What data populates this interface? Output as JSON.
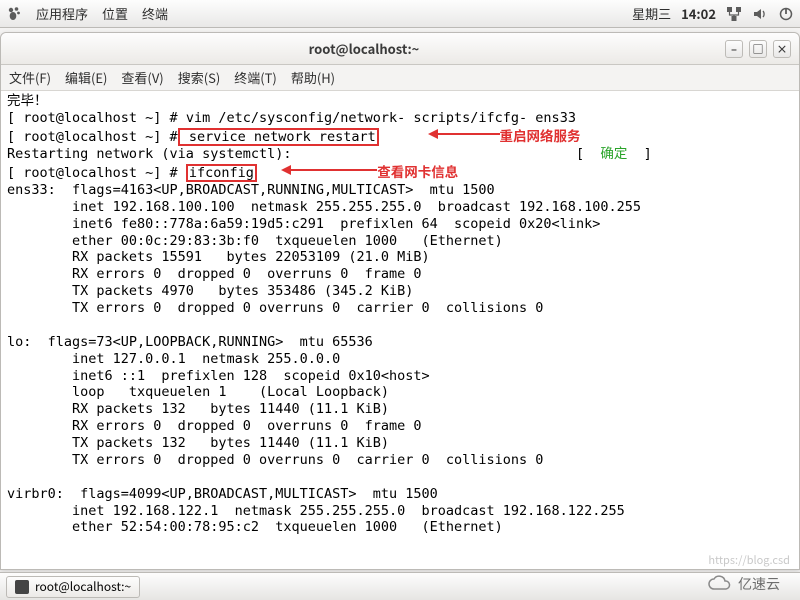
{
  "panel": {
    "apps": "应用程序",
    "places": "位置",
    "terminal": "终端",
    "date": "星期三",
    "time": "14:02"
  },
  "window": {
    "title": "root@localhost:~",
    "minimize": "–",
    "maximize": "□",
    "close": "×"
  },
  "menu": {
    "file": "文件(F)",
    "edit": "编辑(E)",
    "view": "查看(V)",
    "search": "搜索(S)",
    "term": "终端(T)",
    "help": "帮助(H)"
  },
  "annotations": {
    "restart_net": "重启网络服务",
    "ifconfig": "查看网卡信息",
    "ok": "确定"
  },
  "term": {
    "l0": "完毕！",
    "prompt": "[ root@localhost ~] #",
    "cmd_vim": " vim /etc/sysconfig/network- scripts/ifcfg- ens33",
    "cmd_restart": " service network restart",
    "restarting": "Restarting network (via systemctl):",
    "ok_glyph": "[",
    "ok_glyph2": "]",
    "cmd_ifcfg": "ifconfig",
    "ens33_a": "ens33:  flags=4163<UP,BROADCAST,RUNNING,MULTICAST>  mtu 1500",
    "ens33_b": "        inet 192.168.100.100  netmask 255.255.255.0  broadcast 192.168.100.255",
    "ens33_c": "        inet6 fe80::778a:6a59:19d5:c291  prefixlen 64  scopeid 0x20<link>",
    "ens33_d": "        ether 00:0c:29:83:3b:f0  txqueuelen 1000   (Ethernet)",
    "ens33_e": "        RX packets 15591   bytes 22053109 (21.0 MiB)",
    "ens33_f": "        RX errors 0  dropped 0  overruns 0  frame 0",
    "ens33_g": "        TX packets 4970   bytes 353486 (345.2 KiB)",
    "ens33_h": "        TX errors 0  dropped 0 overruns 0  carrier 0  collisions 0",
    "lo_a": "lo:  flags=73<UP,LOOPBACK,RUNNING>  mtu 65536",
    "lo_b": "        inet 127.0.0.1  netmask 255.0.0.0",
    "lo_c": "        inet6 ::1  prefixlen 128  scopeid 0x10<host>",
    "lo_d": "        loop   txqueuelen 1    (Local Loopback)",
    "lo_e": "        RX packets 132   bytes 11440 (11.1 KiB)",
    "lo_f": "        RX errors 0  dropped 0  overruns 0  frame 0",
    "lo_g": "        TX packets 132   bytes 11440 (11.1 KiB)",
    "lo_h": "        TX errors 0  dropped 0 overruns 0  carrier 0  collisions 0",
    "vb_a": "virbr0:  flags=4099<UP,BROADCAST,MULTICAST>  mtu 1500",
    "vb_b": "        inet 192.168.122.1  netmask 255.255.255.0  broadcast 192.168.122.255",
    "vb_c": "        ether 52:54:00:78:95:c2  txqueuelen 1000   (Ethernet)"
  },
  "taskbar": {
    "item": "root@localhost:~"
  },
  "watermark": "https://blog.csd",
  "brand": "亿速云"
}
